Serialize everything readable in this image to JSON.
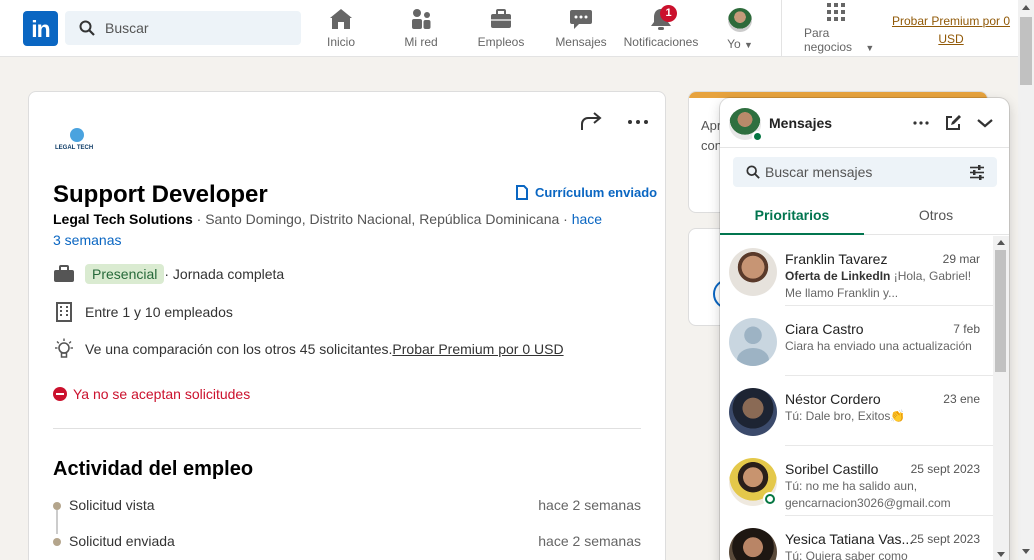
{
  "nav": {
    "logo_text": "in",
    "search_placeholder": "Buscar",
    "items": [
      {
        "label": "Inicio",
        "icon": "home-icon"
      },
      {
        "label": "Mi red",
        "icon": "network-icon"
      },
      {
        "label": "Empleos",
        "icon": "briefcase-icon"
      },
      {
        "label": "Mensajes",
        "icon": "chat-icon"
      },
      {
        "label": "Notificaciones",
        "icon": "bell-icon",
        "badge": "1"
      },
      {
        "label": "Yo",
        "icon": "avatar"
      }
    ],
    "business_label_1": "Para",
    "business_label_2": "negocios",
    "premium_link": "Probar Premium por 0 USD"
  },
  "job": {
    "company_logo_text": "LEGAL TECH",
    "title": "Support Developer",
    "cv_status": "Currículum enviado",
    "company": "Legal Tech Solutions",
    "location": " · Santo Domingo, Distrito Nacional, República Dominicana · ",
    "posted": "hace 3 semanas",
    "workplace_tag": "Presencial",
    "job_type": " · Jornada completa",
    "company_size": "Entre 1 y 10 empleados",
    "comparison_text": "Ve una comparación con los otros 45 solicitantes. ",
    "comparison_link": "Probar Premium por 0 USD",
    "closed_notice": "Ya no se aceptan solicitudes",
    "activity_title": "Actividad del empleo",
    "activity": [
      {
        "label": "Solicitud vista",
        "time": "hace 2 semanas"
      },
      {
        "label": "Solicitud enviada",
        "time": "hace 2 semanas"
      }
    ]
  },
  "right_card": {
    "text_1": "Apr",
    "text_2": "con"
  },
  "messaging": {
    "title": "Mensajes",
    "search_placeholder": "Buscar mensajes",
    "tabs": [
      {
        "label": "Prioritarios",
        "active": true
      },
      {
        "label": "Otros",
        "active": false
      }
    ],
    "conversations": [
      {
        "name": "Franklin Tavarez",
        "date": "29 mar",
        "preview_bold": "Oferta de LinkedIn",
        "preview": " ¡Hola, Gabriel! Me llamo Franklin y..."
      },
      {
        "name": "Ciara Castro",
        "date": "7 feb",
        "preview_bold": "",
        "preview": "Ciara ha enviado una actualización"
      },
      {
        "name": "Néstor Cordero",
        "date": "23 ene",
        "preview_bold": "",
        "preview": "Tú: Dale bro, Exitos👏"
      },
      {
        "name": "Soribel Castillo",
        "date": "25 sept 2023",
        "preview_bold": "",
        "preview": "Tú: no me ha salido aun, gencarnacion3026@gmail.com"
      },
      {
        "name": "Yesica Tatiana Vas...",
        "date": "25 sept 2023",
        "preview_bold": "",
        "preview": "Tú: Quiera saber como"
      }
    ]
  },
  "colors": {
    "brand": "#0a66c2",
    "premium": "#915907",
    "accent_green": "#01754f",
    "badge_red": "#cb112d"
  }
}
